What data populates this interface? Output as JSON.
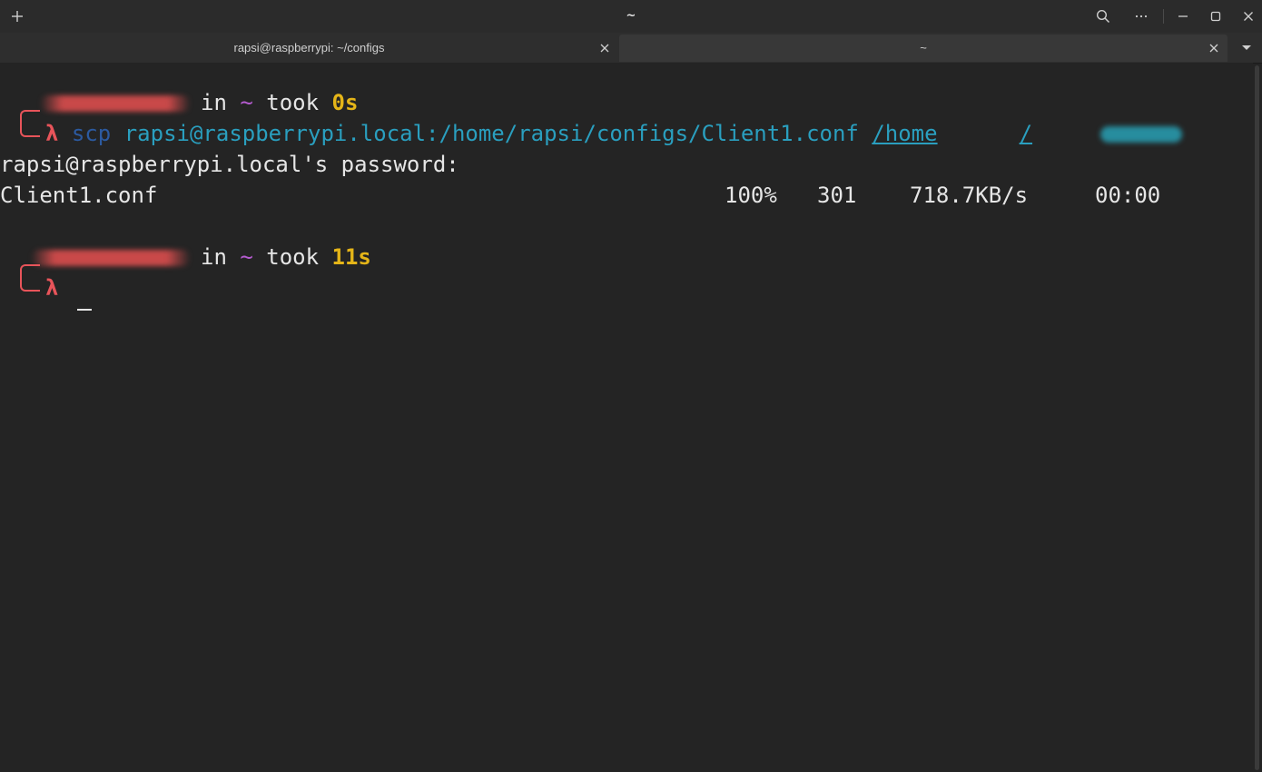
{
  "titlebar": {
    "title": "~",
    "icons": {
      "new_tab": "plus-icon",
      "search": "search-icon",
      "menu": "more-icon",
      "minimize": "minimize-icon",
      "maximize": "maximize-icon",
      "close": "close-icon"
    }
  },
  "tabs": [
    {
      "label": "rapsi@raspberrypi: ~/configs",
      "active": false
    },
    {
      "label": "~",
      "active": true
    }
  ],
  "terminal": {
    "prompt1": {
      "in": "in",
      "tilde": "~",
      "took": "took",
      "duration": "0s",
      "lambda": "λ"
    },
    "command": {
      "cmd": "scp",
      "source": "rapsi@raspberrypi.local:/home/rapsi/configs/Client1.conf",
      "dest_prefix": "/home",
      "dest_suffix": "/"
    },
    "password_prompt": "rapsi@raspberrypi.local's password:",
    "transfer": {
      "file": "Client1.conf",
      "percent": "100%",
      "size": "301",
      "speed": "718.7KB/s",
      "time": "00:00"
    },
    "prompt2": {
      "in": "in",
      "tilde": "~",
      "took": "took",
      "duration": "11s",
      "lambda": "λ"
    }
  },
  "colors": {
    "background": "#242424",
    "prompt_red": "#e8545a",
    "tilde_purple": "#b65cd1",
    "duration_yellow": "#e5b518",
    "command_blue": "#2c5aa0",
    "path_cyan": "#2a9fbf"
  }
}
